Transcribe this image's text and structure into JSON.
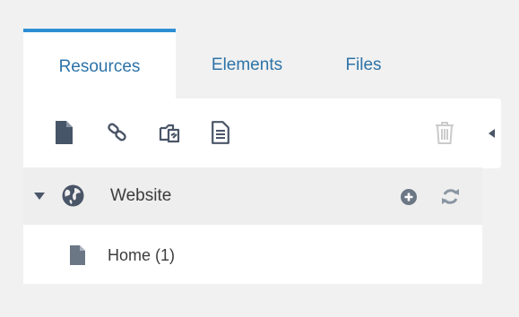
{
  "tabs": [
    {
      "label": "Resources",
      "active": true
    },
    {
      "label": "Elements",
      "active": false
    },
    {
      "label": "Files",
      "active": false
    }
  ],
  "toolbar": {
    "icons": [
      "new-document-icon",
      "weblink-icon",
      "symlink-icon",
      "static-resource-icon",
      "trash-icon"
    ]
  },
  "tree": {
    "site": {
      "label": "Website",
      "expanded": true,
      "icons": [
        "globe-icon",
        "add-circle-icon",
        "refresh-icon"
      ]
    },
    "children": [
      {
        "label": "Home (1)",
        "icon": "document-icon"
      }
    ]
  },
  "colors": {
    "accent": "#2e8ed4",
    "tab_text": "#2d73a8",
    "icon_dark": "#4a5568",
    "icon_light": "#c9c9c9",
    "background": "#f1f1f1"
  }
}
